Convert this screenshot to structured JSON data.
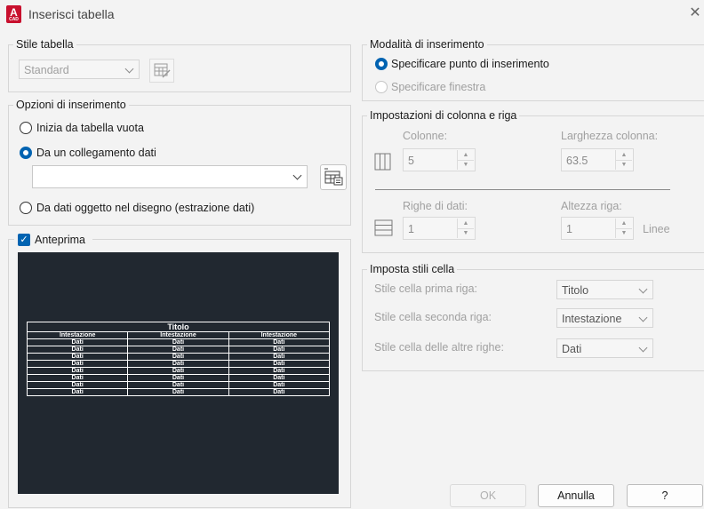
{
  "window": {
    "title": "Inserisci tabella",
    "app_icon_letter": "A",
    "app_icon_sub": "CAD"
  },
  "stile_tabella": {
    "legend": "Stile tabella",
    "value": "Standard"
  },
  "opzioni": {
    "legend": "Opzioni di inserimento",
    "radio_vuota": "Inizia da tabella vuota",
    "radio_collegamento": "Da un collegamento dati",
    "combo_value": "",
    "radio_dati_oggetto": "Da dati oggetto nel disegno (estrazione dati)"
  },
  "anteprima": {
    "label": "Anteprima",
    "table_title": "Titolo",
    "headers": [
      "Intestazione",
      "Intestazione",
      "Intestazione"
    ],
    "rows": [
      [
        "Dati",
        "Dati",
        "Dati"
      ],
      [
        "Dati",
        "Dati",
        "Dati"
      ],
      [
        "Dati",
        "Dati",
        "Dati"
      ],
      [
        "Dati",
        "Dati",
        "Dati"
      ],
      [
        "Dati",
        "Dati",
        "Dati"
      ],
      [
        "Dati",
        "Dati",
        "Dati"
      ],
      [
        "Dati",
        "Dati",
        "Dati"
      ],
      [
        "Dati",
        "Dati",
        "Dati"
      ]
    ]
  },
  "modalita": {
    "legend": "Modalità di inserimento",
    "radio_punto": "Specificare punto di inserimento",
    "radio_finestra": "Specificare finestra"
  },
  "colonna_riga": {
    "legend": "Impostazioni di colonna e riga",
    "colonne_label": "Colonne:",
    "colonne_value": "5",
    "larghezza_label": "Larghezza colonna:",
    "larghezza_value": "63.5",
    "righe_label": "Righe di dati:",
    "righe_value": "1",
    "altezza_label": "Altezza riga:",
    "altezza_value": "1",
    "linee_label": "Linee"
  },
  "stili_cella": {
    "legend": "Imposta stili cella",
    "prima_label": "Stile cella prima riga:",
    "prima_value": "Titolo",
    "seconda_label": "Stile cella seconda riga:",
    "seconda_value": "Intestazione",
    "altre_label": "Stile cella delle altre righe:",
    "altre_value": "Dati"
  },
  "buttons": {
    "ok": "OK",
    "annulla": "Annulla",
    "help": "?"
  }
}
